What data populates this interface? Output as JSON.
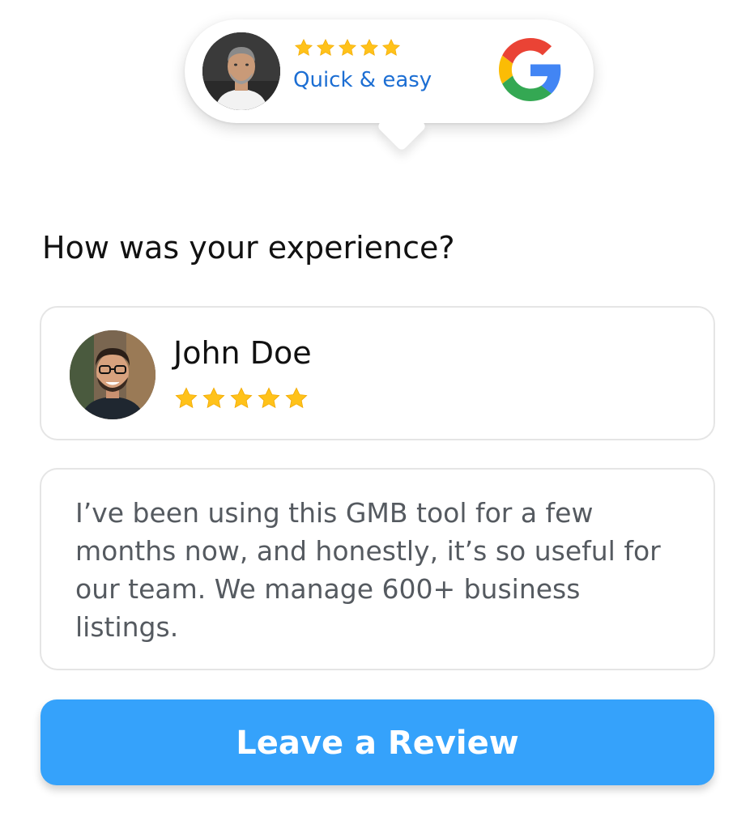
{
  "badge": {
    "rating_stars": 5,
    "tagline": "Quick & easy",
    "logo_icon": "google-g-icon"
  },
  "question": "How was your experience?",
  "reviewer": {
    "name": "John Doe",
    "rating_stars": 5
  },
  "review": {
    "text": "I’ve been using this GMB tool for a few months now, and honestly, it’s so useful for our team. We manage 600+ business listings."
  },
  "cta": {
    "label": "Leave a Review"
  },
  "colors": {
    "star": "#FFC21A",
    "tagline": "#1C6ED3",
    "button": "#35A2FB"
  }
}
